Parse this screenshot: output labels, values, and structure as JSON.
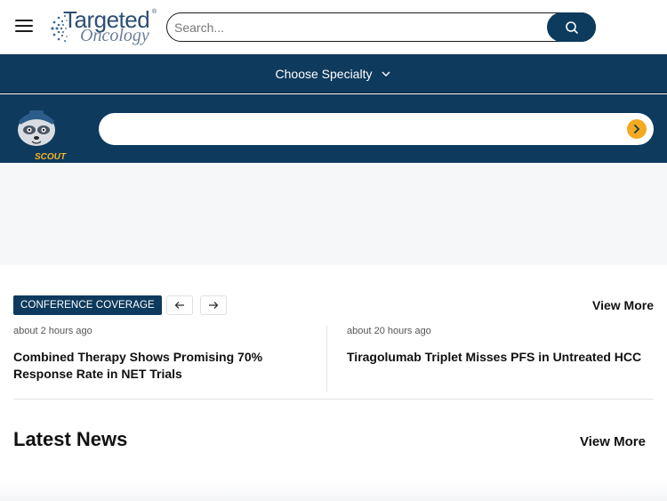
{
  "header": {
    "logo_line1": "Targeted",
    "logo_line2": "Oncology",
    "logo_reg": "®",
    "search_placeholder": "Search..."
  },
  "specialty": {
    "label": "Choose Specialty"
  },
  "scout": {
    "label": "SCOUT",
    "input_value": ""
  },
  "conference": {
    "badge": "CONFERENCE COVERAGE",
    "view_more": "View More",
    "articles": [
      {
        "time": "about 2 hours ago",
        "title": "Combined Therapy Shows Promising 70% Response Rate in NET Trials"
      },
      {
        "time": "about 20 hours ago",
        "title": "Tiragolumab Triplet Misses PFS in Untreated HCC"
      }
    ]
  },
  "latest": {
    "title": "Latest News",
    "view_more": "View More"
  },
  "colors": {
    "brand_navy": "#0e3a5d",
    "accent_orange": "#f4a920"
  }
}
